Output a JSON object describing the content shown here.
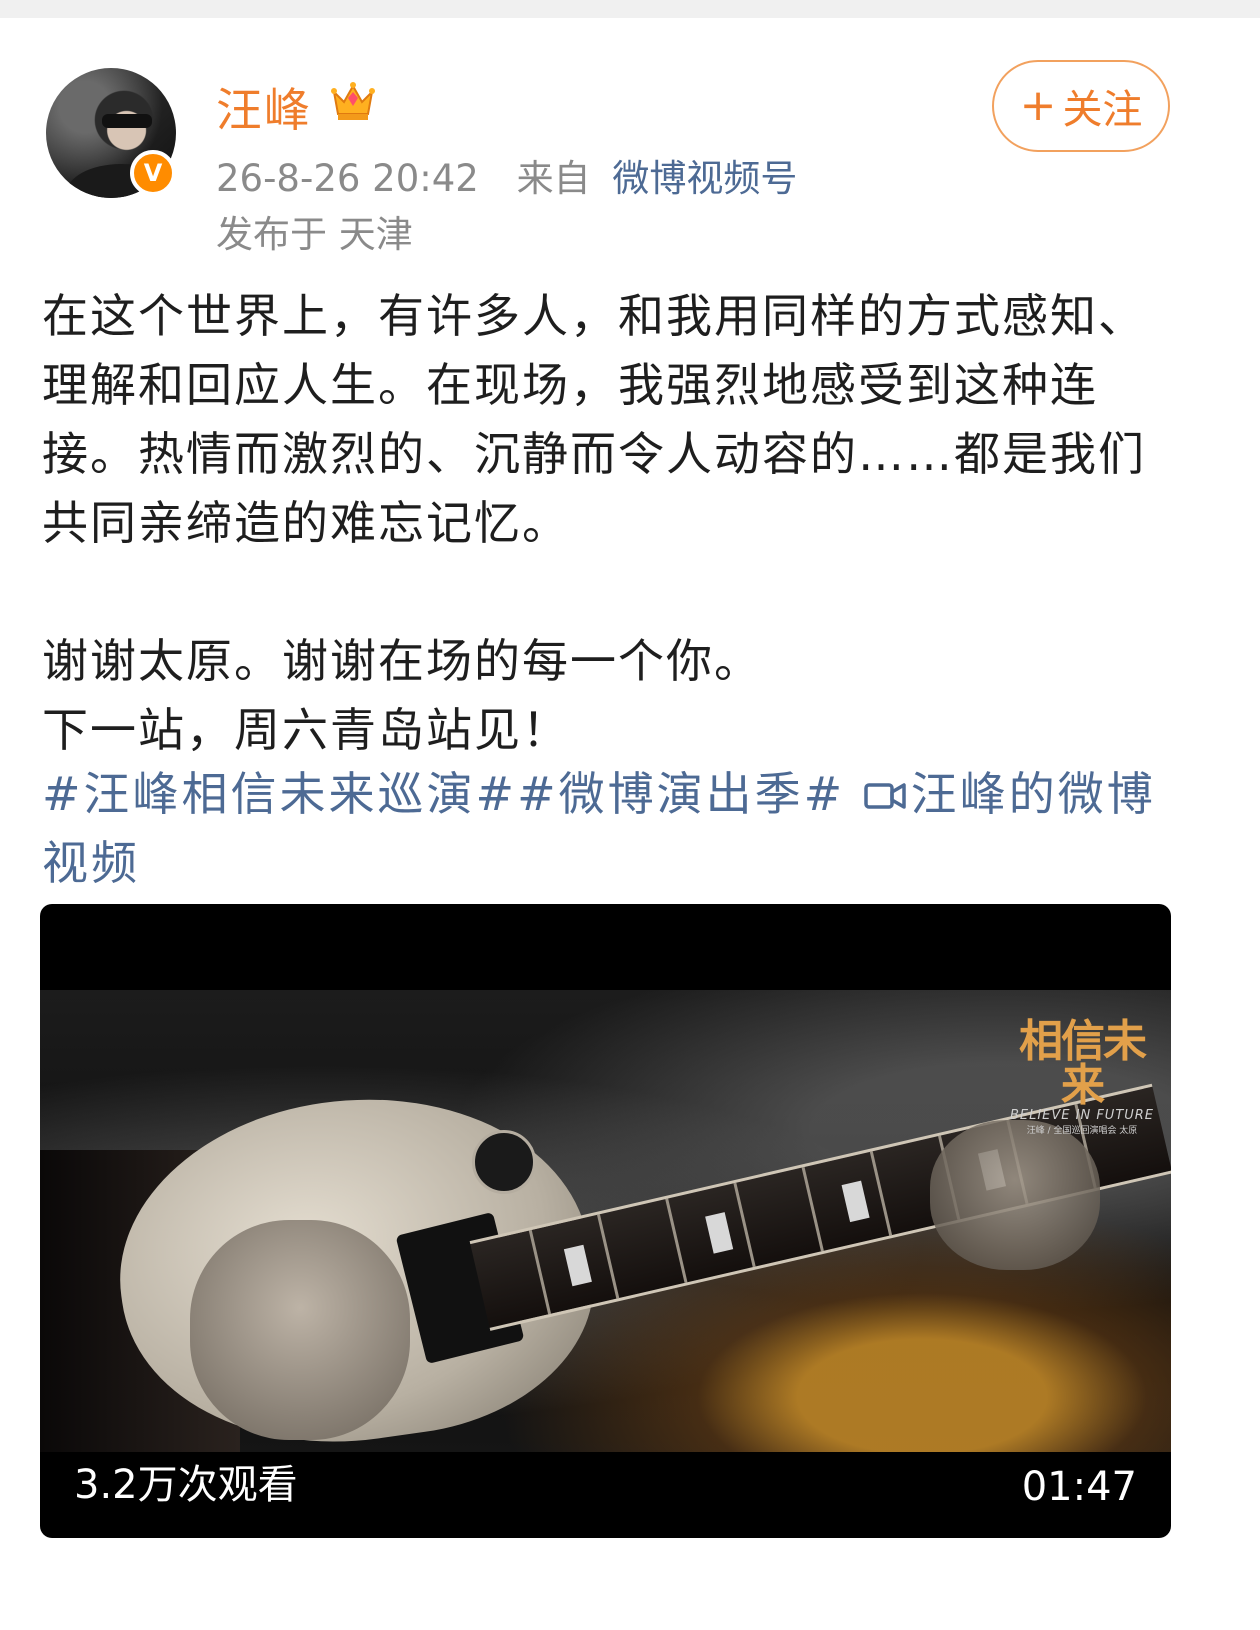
{
  "author": {
    "name": "汪峰",
    "verified": "V"
  },
  "follow_button": {
    "plus": "+",
    "label": "关注"
  },
  "meta": {
    "datetime": "26-8-26 20:42",
    "from_label": "来自",
    "source": "微博视频号",
    "location": "发布于 天津"
  },
  "post": {
    "paragraph1": "在这个世界上，有许多人，和我用同样的方式感知、理解和回应人生。在现场，我强烈地感受到这种连接。热情而激烈的、沉静而令人动容的……都是我们共同亲缔造的难忘记忆。",
    "line2": "谢谢太原。谢谢在场的每一个你。",
    "line3": "下一站，周六青岛站见！",
    "hashtags": "#汪峰相信未来巡演##微博演出季#",
    "video_link": "汪峰的微博视频"
  },
  "video": {
    "logo_title": "相信未来",
    "logo_sub": "BELIEVE IN FUTURE",
    "logo_small": "汪峰 / 全国巡回演唱会 太原",
    "view_count": "3.2万次观看",
    "duration": "01:47"
  },
  "colors": {
    "name": "#ef7d2c",
    "link": "#4d6a94",
    "meta": "#8a8a8a",
    "verified": "#ff8c00"
  }
}
